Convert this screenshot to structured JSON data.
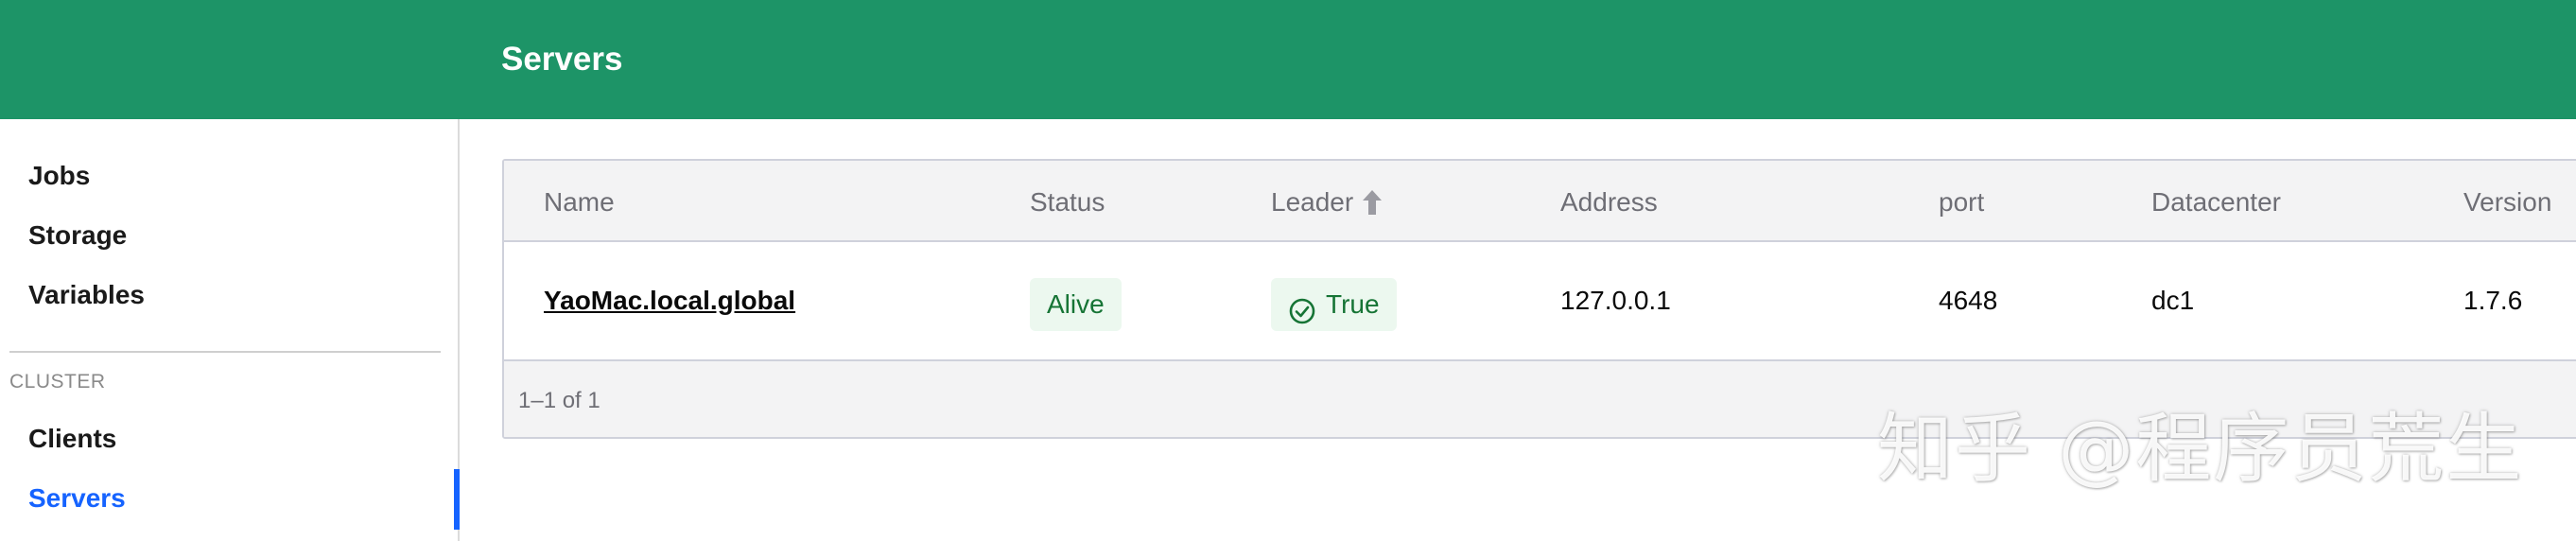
{
  "header": {
    "title": "Servers"
  },
  "sidebar": {
    "items": [
      {
        "label": "Jobs"
      },
      {
        "label": "Storage"
      },
      {
        "label": "Variables"
      }
    ],
    "cluster_label": "CLUSTER",
    "cluster_items": [
      {
        "label": "Clients"
      },
      {
        "label": "Servers",
        "active": true
      }
    ]
  },
  "table": {
    "columns": [
      "Name",
      "Status",
      "Leader",
      "Address",
      "port",
      "Datacenter",
      "Version"
    ],
    "sort": {
      "column": "Leader",
      "direction": "ascending"
    },
    "rows": [
      {
        "name": "YaoMac.local.global",
        "status": "Alive",
        "leader": "True",
        "address": "127.0.0.1",
        "port": "4648",
        "datacenter": "dc1",
        "version": "1.7.6"
      }
    ],
    "footer": "1–1 of 1"
  },
  "watermark": "知乎 @程序员荒生",
  "colors": {
    "header_bg": "#1d9467",
    "active_nav": "#1563ff",
    "status_badge_bg": "#ecf8ef",
    "status_badge_text": "#167435"
  },
  "icons": {
    "sort": "arrow-up-icon",
    "leader_badge": "check-circle-icon"
  }
}
